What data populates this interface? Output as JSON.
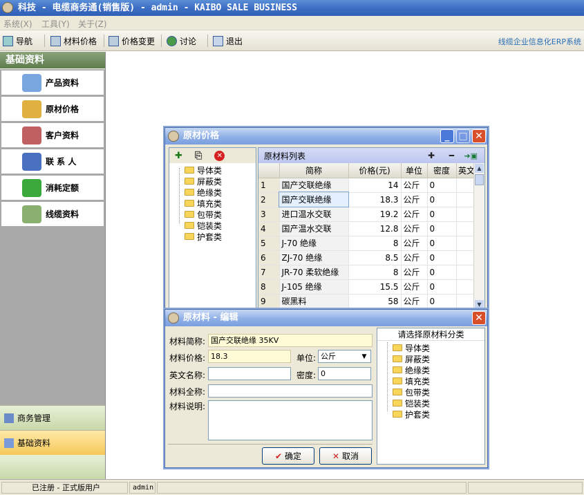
{
  "app": {
    "title": "科技 - 电缆商务通(销售版) - admin - KAIBO SALE BUSINESS"
  },
  "menu": [
    "系统(X)",
    "工具(Y)",
    "关于(Z)"
  ],
  "toolbar": {
    "items": [
      "导航",
      "材料价格",
      "价格变更",
      "讨论",
      "退出"
    ],
    "link": "线缆企业信息化ERP系统"
  },
  "sidebar": {
    "header": "基础资料",
    "items": [
      "产品资料",
      "原材价格",
      "客户资料",
      "联 系 人",
      "消耗定额",
      "线缆资料"
    ],
    "bottom_tabs": [
      "商务管理",
      "基础资料"
    ]
  },
  "status": {
    "reg": "已注册 - 正式版用户",
    "user": "admin"
  },
  "win1": {
    "title": "原材价格",
    "list_title": "原材料列表",
    "tree": [
      "导体类",
      "屏蔽类",
      "绝缘类",
      "填充类",
      "包带类",
      "铠装类",
      "护套类"
    ],
    "columns": [
      "简称",
      "价格(元)",
      "单位",
      "密度",
      "英文"
    ],
    "rows": [
      {
        "n": "1",
        "name": "国产交联绝缘",
        "price": "14",
        "unit": "公斤",
        "den": "0"
      },
      {
        "n": "2",
        "name": "国产交联绝缘",
        "price": "18.3",
        "unit": "公斤",
        "den": "0"
      },
      {
        "n": "3",
        "name": "进口温水交联",
        "price": "19.2",
        "unit": "公斤",
        "den": "0"
      },
      {
        "n": "4",
        "name": "国产温水交联",
        "price": "12.8",
        "unit": "公斤",
        "den": "0"
      },
      {
        "n": "5",
        "name": "J-70  绝缘",
        "price": "8",
        "unit": "公斤",
        "den": "0"
      },
      {
        "n": "6",
        "name": "ZJ-70  绝缘",
        "price": "8.5",
        "unit": "公斤",
        "den": "0"
      },
      {
        "n": "7",
        "name": "JR-70 柔软绝缘",
        "price": "8",
        "unit": "公斤",
        "den": "0"
      },
      {
        "n": "8",
        "name": "J-105  绝缘",
        "price": "15.5",
        "unit": "公斤",
        "den": "0"
      },
      {
        "n": "9",
        "name": "碳黑料",
        "price": "58",
        "unit": "公斤",
        "den": "0"
      }
    ]
  },
  "win2": {
    "title": "原材料 - 编辑",
    "labels": {
      "short": "材料简称:",
      "price": "材料价格:",
      "unit": "单位:",
      "en": "英文名称:",
      "density": "密度:",
      "full": "材料全称:",
      "desc": "材料说明:"
    },
    "values": {
      "short": "国产交联绝缘 35KV",
      "price": "18.3",
      "unit": "公斤",
      "en": "",
      "density": "0",
      "full": "",
      "desc": ""
    },
    "tree_title": "请选择原材料分类",
    "tree": [
      "导体类",
      "屏蔽类",
      "绝缘类",
      "填充类",
      "包带类",
      "铠装类",
      "护套类"
    ],
    "ok": "确定",
    "cancel": "取消"
  }
}
